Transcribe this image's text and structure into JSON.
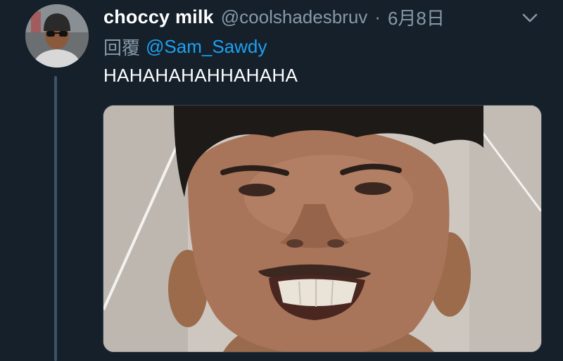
{
  "tweet": {
    "display_name": "choccy milk",
    "handle": "@coolshadesbruv",
    "separator": "·",
    "timestamp": "6月8日",
    "reply_prefix": "回覆",
    "reply_to": "@Sam_Sawdy",
    "text": "HAHAHAHAHHAHAHA"
  },
  "icons": {
    "menu": "chevron-down-icon"
  },
  "colors": {
    "background": "#15202b",
    "primary_text": "#ffffff",
    "secondary_text": "#8899a6",
    "link": "#1da1f2",
    "thread_line": "#3d5466"
  }
}
